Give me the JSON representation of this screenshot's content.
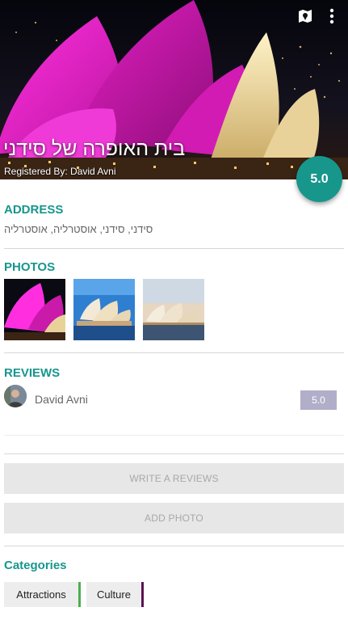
{
  "header": {
    "title": "בית האופרה של סידני",
    "subtitle": "Registered By: David Avni",
    "map_icon": "map-marker-icon",
    "menu_icon": "more-vert-icon"
  },
  "rating": {
    "value": "5.0"
  },
  "address": {
    "heading": "ADDRESS",
    "text": "סידני, סידני, אוסטרליה, אוסטרליה"
  },
  "photos": {
    "heading": "PHOTOS"
  },
  "reviews": {
    "heading": "REVIEWS",
    "items": [
      {
        "name": "David Avni",
        "score": "5.0"
      }
    ]
  },
  "actions": {
    "write_review": "WRITE A REVIEWS",
    "add_photo": "ADD PHOTO"
  },
  "categories": {
    "heading": "Categories",
    "items": [
      {
        "label": "Attractions",
        "color": "#4caf50"
      },
      {
        "label": "Culture",
        "color": "#5b1353"
      }
    ]
  },
  "colors": {
    "accent": "#17968c",
    "score_badge": "#b0aec8"
  }
}
